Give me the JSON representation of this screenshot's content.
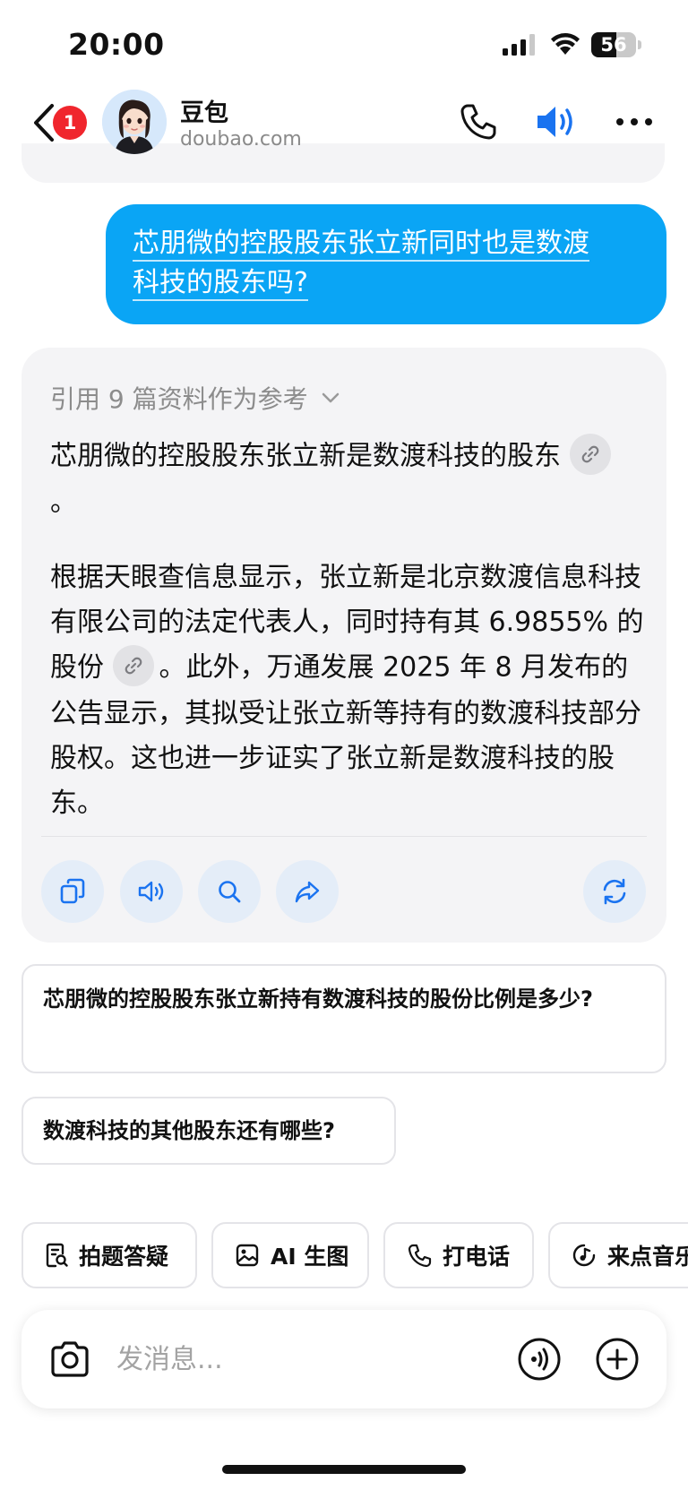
{
  "status_bar": {
    "time": "20:00",
    "battery_level": "56",
    "battery_fraction": 0.56,
    "icons": [
      "signal-icon",
      "wifi-icon",
      "battery-icon"
    ]
  },
  "header": {
    "notification_count": "1",
    "bot_name": "豆包",
    "bot_domain": "doubao.com",
    "icons": [
      "back-icon",
      "avatar",
      "phone-icon",
      "speaker-icon",
      "more-icon"
    ],
    "accent_color": "#1a73f0"
  },
  "user_message": {
    "text": "芯朋微的控股股东张立新同时也是数渡科技的股东吗?",
    "line1": "芯朋微的控股股东张立新同时也是数渡",
    "line2": "科技的股东吗?",
    "bubble_color": "#0aa5f5"
  },
  "assistant_message": {
    "references_label": "引用 9 篇资料作为参考",
    "p1_text": "芯朋微的控股股东张立新是数渡科技的股东",
    "p1_end": "。",
    "p2_part1": "根据天眼查信息显示，张立新是北京数渡信息科技有限公司的法定代表人，同时持有其 6.9855% 的股份",
    "p2_part2": "。此外，万通发展 2025 年 8 月发布的公告显示，其拟受让张立新等持有的数渡科技部分股权。这也进一步证实了张立新是数渡科技的股东。",
    "actions": [
      "copy-icon",
      "read-aloud-icon",
      "search-icon",
      "share-icon",
      "regenerate-icon"
    ]
  },
  "suggestions": [
    "芯朋微的控股股东张立新持有数渡科技的股份比例是多少?",
    "数渡科技的其他股东还有哪些?"
  ],
  "tools": [
    {
      "label": "拍题答疑",
      "icon": "photo-question-icon"
    },
    {
      "label": "AI 生图",
      "icon": "image-icon"
    },
    {
      "label": "打电话",
      "icon": "phone-icon"
    },
    {
      "label": "来点音乐",
      "icon": "music-icon"
    }
  ],
  "input": {
    "placeholder": "发消息...",
    "value": "",
    "icons": [
      "camera-icon",
      "voice-icon",
      "plus-icon"
    ]
  }
}
